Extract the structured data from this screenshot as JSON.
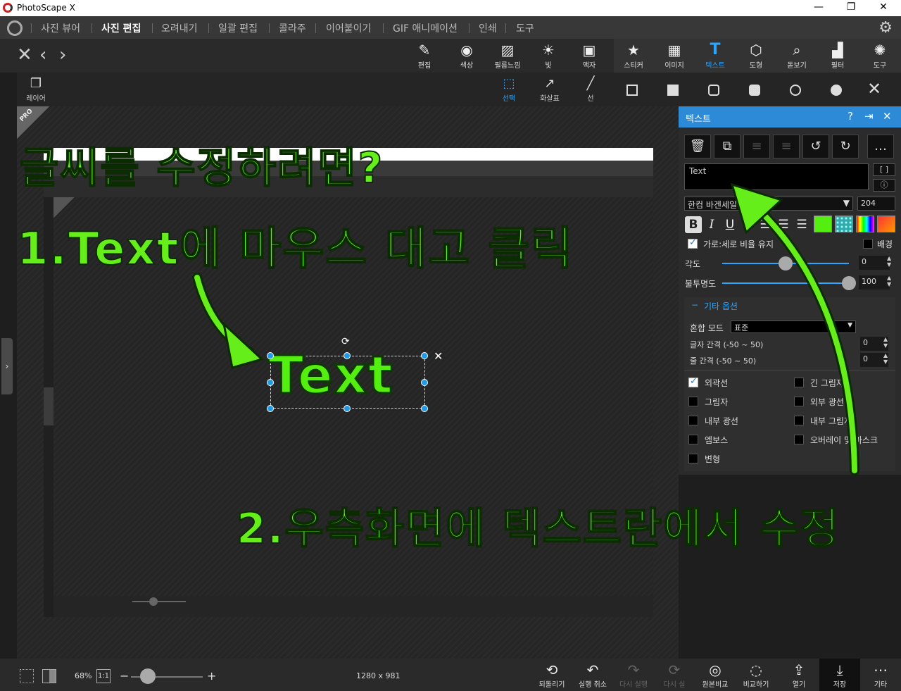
{
  "window": {
    "title": "PhotoScape X",
    "controls": [
      "—",
      "❐",
      "✕"
    ]
  },
  "menu": {
    "items": [
      "사진 뷰어",
      "사진 편집",
      "오려내기",
      "일괄 편집",
      "콜라주",
      "이어붙이기",
      "GIF 애니메이션",
      "인쇄",
      "도구"
    ],
    "active": "사진 편집"
  },
  "toolbar": {
    "tools": [
      {
        "label": "편집",
        "icon": "✎"
      },
      {
        "label": "색상",
        "icon": "◉"
      },
      {
        "label": "필름느낌",
        "icon": "▨"
      },
      {
        "label": "빛",
        "icon": "☀"
      },
      {
        "label": "액자",
        "icon": "▣"
      },
      {
        "label": "스티커",
        "icon": "★"
      },
      {
        "label": "이미지",
        "icon": "▦"
      },
      {
        "label": "텍스트",
        "icon": "T"
      },
      {
        "label": "도형",
        "icon": "⬡"
      },
      {
        "label": "돋보기",
        "icon": "⌕"
      },
      {
        "label": "필터",
        "icon": "▟"
      },
      {
        "label": "도구",
        "icon": "✺"
      }
    ],
    "selected": "텍스트"
  },
  "subtoolbar": {
    "layer_label": "레이어",
    "select_label": "선택",
    "arrow_label": "화살표",
    "line_label": "선"
  },
  "canvas": {
    "pro_badge": "PRO",
    "text_object": "Text"
  },
  "annotations": {
    "title": "글씨를 수정하려면?",
    "step1": "1.Text에 마우스 대고 클릭",
    "step2": "2.우측화면에 텍스트란에서 수정"
  },
  "panel": {
    "title": "텍스트",
    "text_value": "Text",
    "bracket_btn": "[ ]",
    "info_btn": "ⓘ",
    "font": "한컴 바겐세일",
    "font_size": "204",
    "aspect_label": "가로:세로 비율 유지",
    "aspect_checked": true,
    "background_label": "배경",
    "background_checked": false,
    "angle_label": "각도",
    "angle_value": "0",
    "angle_fraction": 0.5,
    "opacity_label": "불투명도",
    "opacity_value": "100",
    "opacity_fraction": 1.0,
    "more_options_label": "기타 옵션",
    "blend_label": "혼합 모드",
    "blend_value": "표준",
    "char_spacing_label": "글자 간격 (-50 ~ 50)",
    "char_spacing_value": "0",
    "line_spacing_label": "줄 간격 (-50 ~ 50)",
    "line_spacing_value": "0",
    "options": [
      {
        "label": "외곽선",
        "checked": true
      },
      {
        "label": "긴 그림자",
        "checked": false
      },
      {
        "label": "그림자",
        "checked": false
      },
      {
        "label": "외부 광선",
        "checked": false
      },
      {
        "label": "내부 광선",
        "checked": false
      },
      {
        "label": "내부 그림자",
        "checked": false
      },
      {
        "label": "엠보스",
        "checked": false
      },
      {
        "label": "오버레이 및 마스크",
        "checked": false
      },
      {
        "label": "변형",
        "checked": false
      }
    ],
    "colors": {
      "accent": "#2d8ad6",
      "text_color": "#55ee11"
    }
  },
  "bottombar": {
    "zoom": "68%",
    "ratio_btn": "1:1",
    "dimensions": "1280 x 981",
    "buttons": [
      {
        "label": "되돌리기",
        "icon": "⟲",
        "enabled": true
      },
      {
        "label": "실행 취소",
        "icon": "↶",
        "enabled": true
      },
      {
        "label": "다시 실행",
        "icon": "↷",
        "enabled": false
      },
      {
        "label": "다시 실",
        "icon": "⟳",
        "enabled": false
      },
      {
        "label": "원본비교",
        "icon": "◎",
        "enabled": true
      },
      {
        "label": "비교하기",
        "icon": "◌",
        "enabled": true
      },
      {
        "label": "열기",
        "icon": "⇪",
        "enabled": true
      },
      {
        "label": "저장",
        "icon": "⤓",
        "enabled": true
      },
      {
        "label": "기타",
        "icon": "⋯",
        "enabled": true
      }
    ]
  }
}
